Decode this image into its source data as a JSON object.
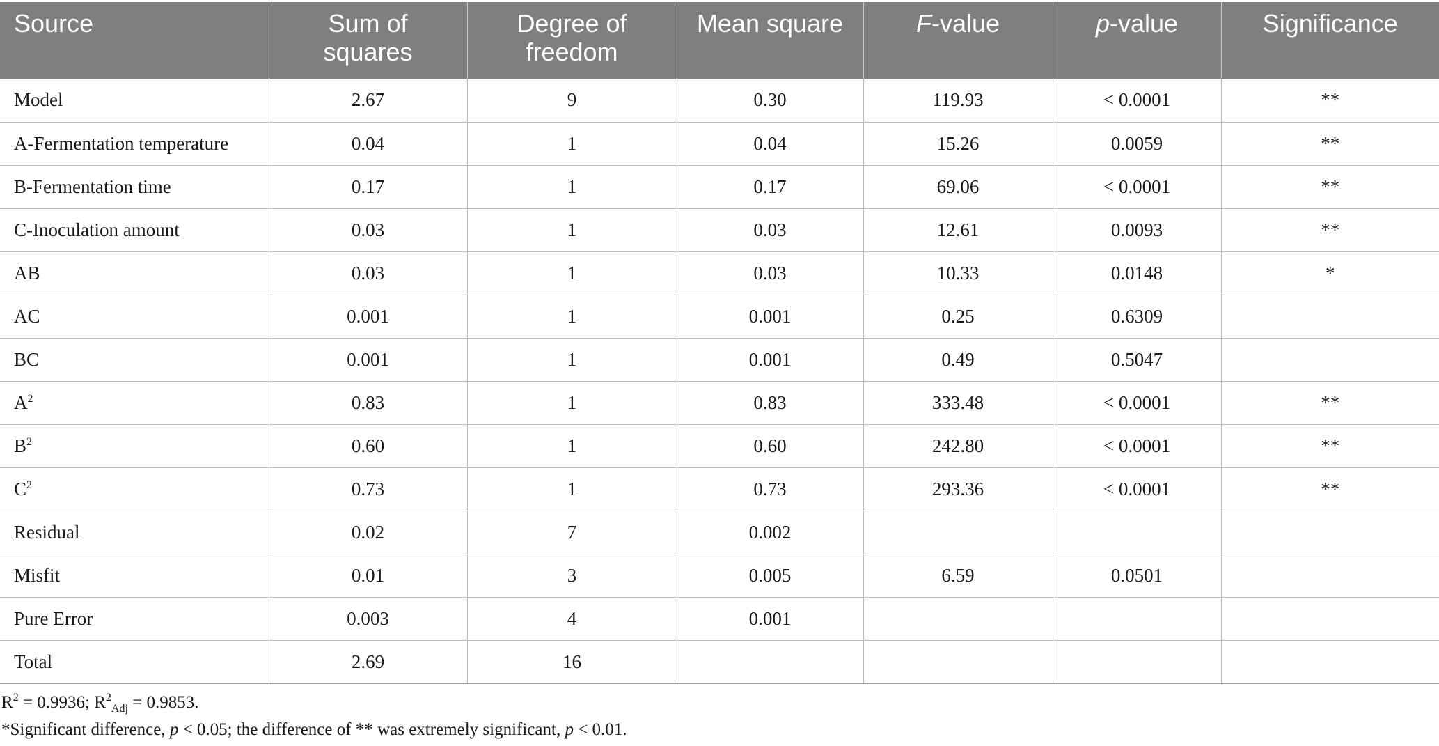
{
  "table": {
    "headers": {
      "source": "Source",
      "sum_of_squares_1": "Sum of",
      "sum_of_squares_2": "squares",
      "df_1": "Degree of",
      "df_2": "freedom",
      "mean_square": "Mean square",
      "f_italic": "F",
      "f_rest": "-value",
      "p_italic": "p",
      "p_rest": "-value",
      "significance": "Significance"
    },
    "rows": [
      {
        "source": "Model",
        "ss": "2.67",
        "df": "9",
        "ms": "0.30",
        "f": "119.93",
        "p": "< 0.0001",
        "sig": "**"
      },
      {
        "source": "A-Fermentation temperature",
        "ss": "0.04",
        "df": "1",
        "ms": "0.04",
        "f": "15.26",
        "p": "0.0059",
        "sig": "**"
      },
      {
        "source": "B-Fermentation time",
        "ss": "0.17",
        "df": "1",
        "ms": "0.17",
        "f": "69.06",
        "p": "< 0.0001",
        "sig": "**"
      },
      {
        "source": "C-Inoculation amount",
        "ss": "0.03",
        "df": "1",
        "ms": "0.03",
        "f": "12.61",
        "p": "0.0093",
        "sig": "**"
      },
      {
        "source": "AB",
        "ss": "0.03",
        "df": "1",
        "ms": "0.03",
        "f": "10.33",
        "p": "0.0148",
        "sig": "*"
      },
      {
        "source": "AC",
        "ss": "0.001",
        "df": "1",
        "ms": "0.001",
        "f": "0.25",
        "p": "0.6309",
        "sig": ""
      },
      {
        "source": "BC",
        "ss": "0.001",
        "df": "1",
        "ms": "0.001",
        "f": "0.49",
        "p": "0.5047",
        "sig": ""
      },
      {
        "source": "A",
        "source_sup": "2",
        "ss": "0.83",
        "df": "1",
        "ms": "0.83",
        "f": "333.48",
        "p": "< 0.0001",
        "sig": "**"
      },
      {
        "source": "B",
        "source_sup": "2",
        "ss": "0.60",
        "df": "1",
        "ms": "0.60",
        "f": "242.80",
        "p": "< 0.0001",
        "sig": "**"
      },
      {
        "source": "C",
        "source_sup": "2",
        "ss": "0.73",
        "df": "1",
        "ms": "0.73",
        "f": "293.36",
        "p": "< 0.0001",
        "sig": "**"
      },
      {
        "source": "Residual",
        "ss": "0.02",
        "df": "7",
        "ms": "0.002",
        "f": "",
        "p": "",
        "sig": ""
      },
      {
        "source": "Misfit",
        "ss": "0.01",
        "df": "3",
        "ms": "0.005",
        "f": "6.59",
        "p": "0.0501",
        "sig": ""
      },
      {
        "source": "Pure Error",
        "ss": "0.003",
        "df": "4",
        "ms": "0.001",
        "f": "",
        "p": "",
        "sig": ""
      },
      {
        "source": "Total",
        "ss": "2.69",
        "df": "16",
        "ms": "",
        "f": "",
        "p": "",
        "sig": ""
      }
    ]
  },
  "footnotes": {
    "r2_label": "R",
    "r2_sup": "2",
    "r2_value": " = 0.9936; ",
    "r2adj_label": "R",
    "r2adj_sup": "2",
    "r2adj_sub": "Adj",
    "r2adj_value": " = 0.9853.",
    "sig_part1": "*Significant difference, ",
    "sig_p1": "p",
    "sig_part2": " < 0.05; the difference of ** was extremely significant, ",
    "sig_p2": "p",
    "sig_part3": " < 0.01."
  }
}
